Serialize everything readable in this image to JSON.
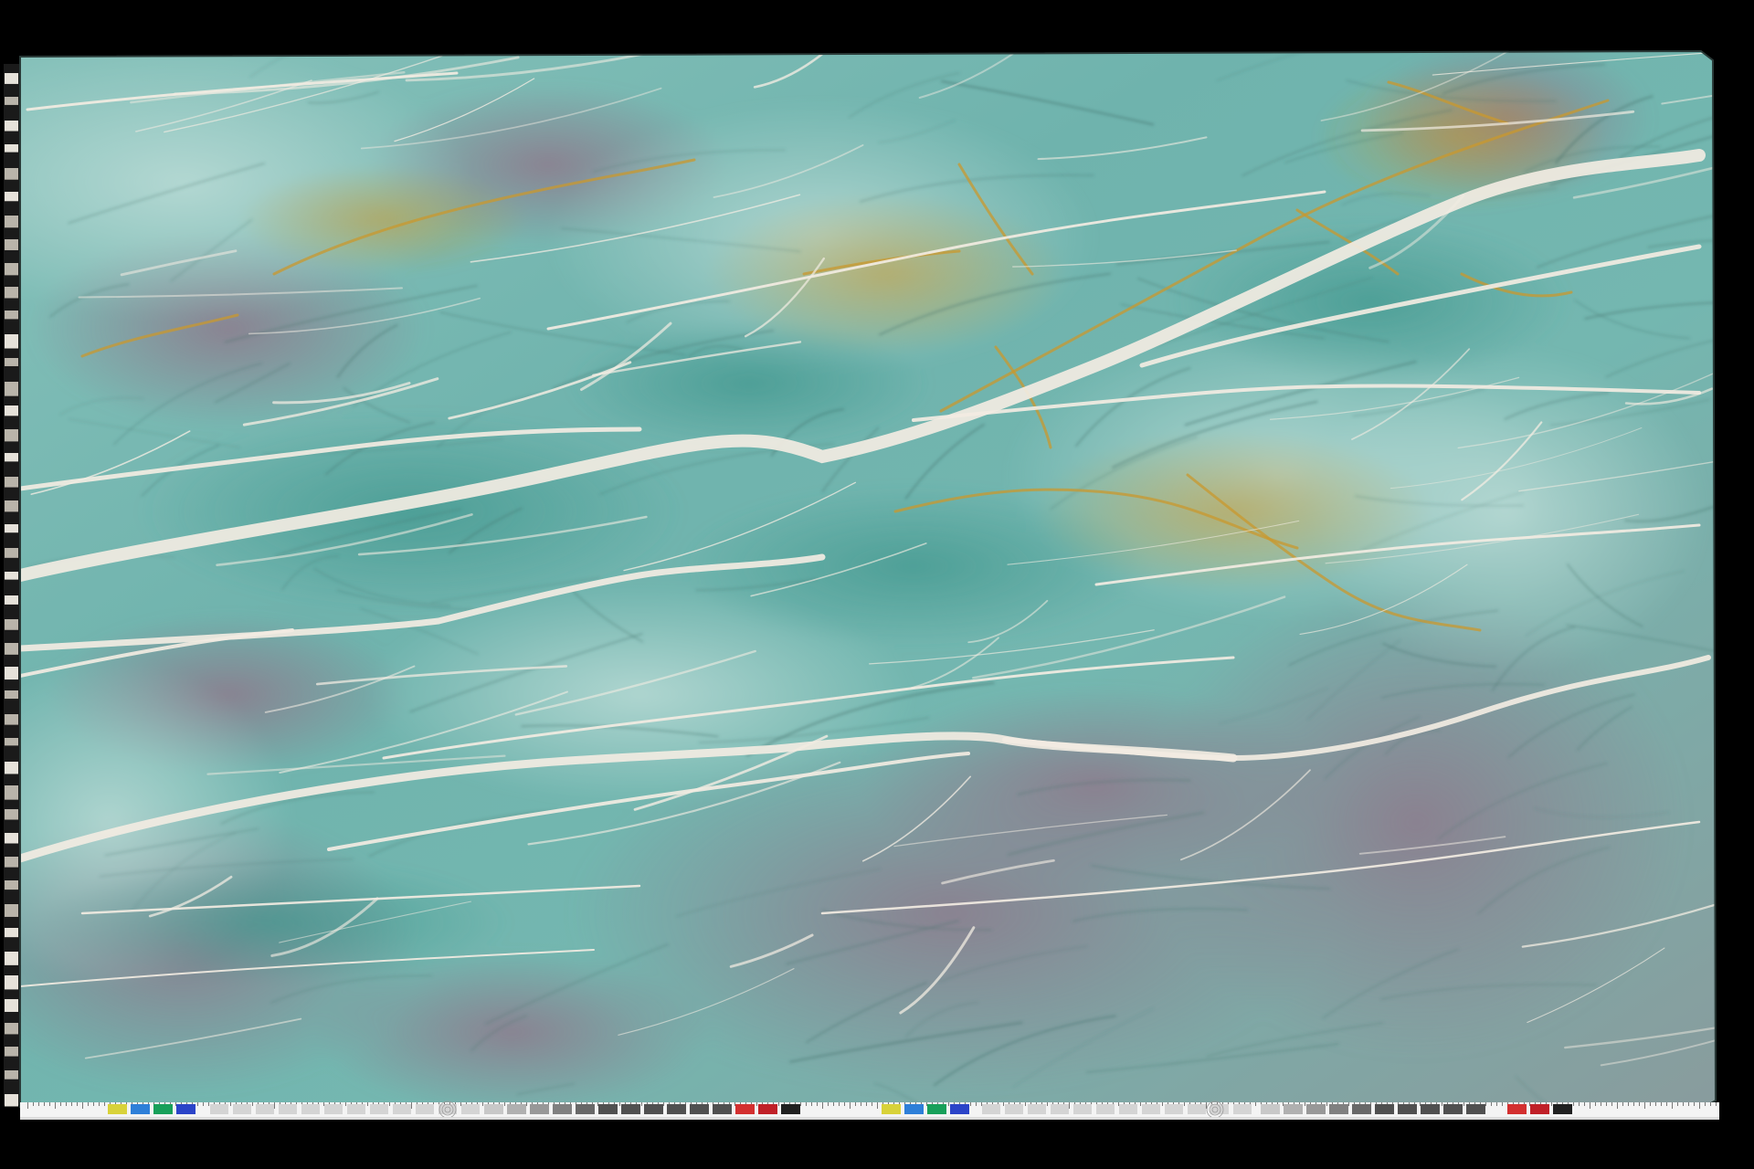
{
  "image": {
    "subject": "slab",
    "colors": {
      "background": "#000000",
      "slab_base": "#6fb3ad",
      "slab_light": "#9fcfc8",
      "slab_deep": "#4f9a92",
      "purple_zone": "#8e7d8f",
      "vein_white": "#f2ece2",
      "vein_gold": "#c9982e",
      "vein_dark": "#3f6d67",
      "ruler_white": "#f4f4f4",
      "ruler_gray": "#5a5a5a"
    },
    "ruler_swatches": [
      "#d8d23a",
      "#2e7fd8",
      "#18a05a",
      "#2b44c8",
      "#c8c8c8",
      "#b0b0b0",
      "#989898",
      "#808080",
      "#686868",
      "#505050",
      "#d33030",
      "#c02028",
      "#202020",
      "#d8d23a",
      "#2e7fd8",
      "#18a05a",
      "#2b44c8",
      "#c8c8c8",
      "#b0b0b0",
      "#989898",
      "#808080",
      "#686868",
      "#505050",
      "#d33030",
      "#c02028",
      "#202020"
    ]
  }
}
